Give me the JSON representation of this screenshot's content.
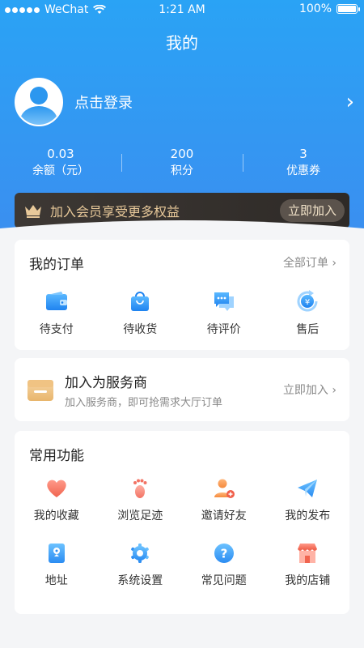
{
  "status_bar": {
    "carrier": "WeChat",
    "time": "1:21 AM",
    "battery": "100%"
  },
  "page": {
    "title": "我的"
  },
  "profile": {
    "login_label": "点击登录",
    "arrow": "›"
  },
  "stats": [
    {
      "value": "0.03",
      "label": "余额（元）"
    },
    {
      "value": "200",
      "label": "积分"
    },
    {
      "value": "3",
      "label": "优惠券"
    }
  ],
  "vip": {
    "text": "加入会员享受更多权益",
    "button": "立即加入"
  },
  "orders": {
    "title": "我的订单",
    "link": "全部订单 ›",
    "items": [
      {
        "label": "待支付",
        "icon": "wallet-icon"
      },
      {
        "label": "待收货",
        "icon": "shopping-bag-icon"
      },
      {
        "label": "待评价",
        "icon": "chat-icon"
      },
      {
        "label": "售后",
        "icon": "yuan-refresh-icon"
      }
    ]
  },
  "provider": {
    "title": "加入为服务商",
    "subtitle": "加入服务商，即可抢需求大厅订单",
    "link": "立即加入 ›"
  },
  "features": {
    "title": "常用功能",
    "items": [
      {
        "label": "我的收藏",
        "icon": "heart-icon"
      },
      {
        "label": "浏览足迹",
        "icon": "footprint-icon"
      },
      {
        "label": "邀请好友",
        "icon": "add-user-icon"
      },
      {
        "label": "我的发布",
        "icon": "paper-plane-icon"
      },
      {
        "label": "地址",
        "icon": "address-book-icon"
      },
      {
        "label": "系统设置",
        "icon": "gear-icon"
      },
      {
        "label": "常见问题",
        "icon": "question-icon"
      },
      {
        "label": "我的店铺",
        "icon": "store-icon"
      }
    ]
  },
  "colors": {
    "primary": "#2f93f0",
    "gold": "#e8c99a",
    "vip_bg": "#3a3531"
  }
}
